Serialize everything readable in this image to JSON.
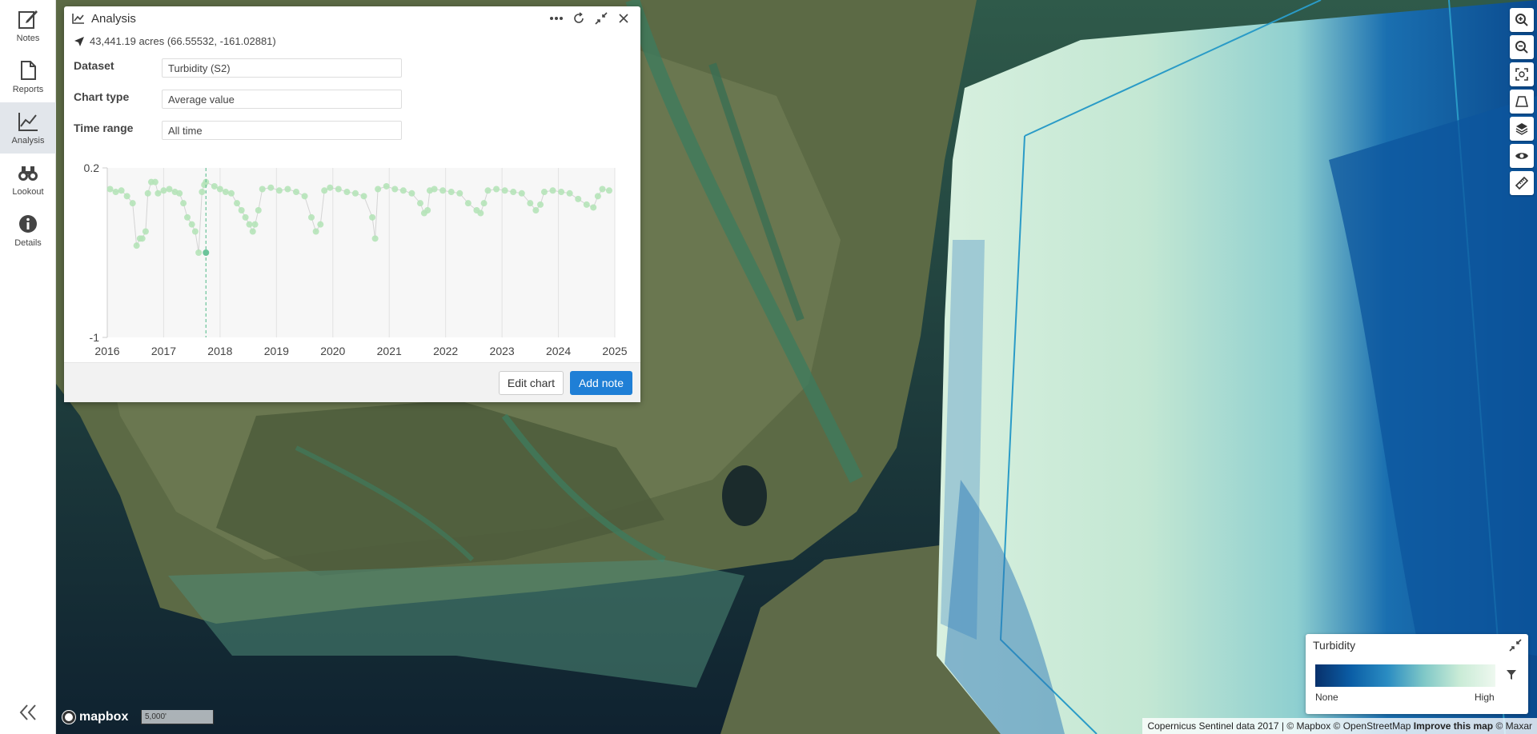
{
  "nav": {
    "items": [
      {
        "label": "Notes",
        "icon": "edit-icon"
      },
      {
        "label": "Reports",
        "icon": "document-icon"
      },
      {
        "label": "Analysis",
        "icon": "chart-icon",
        "active": true
      },
      {
        "label": "Lookout",
        "icon": "binoculars-icon"
      },
      {
        "label": "Details",
        "icon": "info-icon"
      }
    ]
  },
  "panel": {
    "title": "Analysis",
    "location": "43,441.19 acres (66.55532, -161.02881)",
    "fields": [
      {
        "label": "Dataset",
        "value": "Turbidity (S2)"
      },
      {
        "label": "Chart type",
        "value": "Average value"
      },
      {
        "label": "Time range",
        "value": "All time"
      }
    ],
    "edit_label": "Edit chart",
    "add_label": "Add note"
  },
  "chart_data": {
    "type": "scatter",
    "title": "",
    "xlabel": "",
    "ylabel": "",
    "x_ticks": [
      "2016",
      "2017",
      "2018",
      "2019",
      "2020",
      "2021",
      "2022",
      "2023",
      "2024",
      "2025"
    ],
    "y_ticks": [
      "0.2",
      "-1"
    ],
    "ylim": [
      -1,
      0.2
    ],
    "xlim": [
      2016,
      2025
    ],
    "grid": true,
    "color": "#b5e3b8",
    "highlight_x": 2017.75,
    "series": [
      {
        "x": [
          2016.05,
          2016.15,
          2016.25,
          2016.35,
          2016.45,
          2016.52,
          2016.58,
          2016.62,
          2016.68,
          2016.72,
          2016.78,
          2016.85,
          2016.9,
          2017.0,
          2017.1,
          2017.2,
          2017.28,
          2017.35,
          2017.42,
          2017.5,
          2017.56,
          2017.62,
          2017.68,
          2017.72,
          2017.75,
          2017.9,
          2018.0,
          2018.1,
          2018.2,
          2018.3,
          2018.38,
          2018.45,
          2018.52,
          2018.58,
          2018.62,
          2018.68,
          2018.75,
          2018.9,
          2019.05,
          2019.2,
          2019.35,
          2019.5,
          2019.62,
          2019.7,
          2019.78,
          2019.85,
          2019.95,
          2020.1,
          2020.25,
          2020.4,
          2020.55,
          2020.7,
          2020.75,
          2020.8,
          2020.95,
          2021.1,
          2021.25,
          2021.4,
          2021.55,
          2021.62,
          2021.68,
          2021.72,
          2021.8,
          2021.95,
          2022.1,
          2022.25,
          2022.4,
          2022.55,
          2022.62,
          2022.68,
          2022.75,
          2022.9,
          2023.05,
          2023.2,
          2023.35,
          2023.5,
          2023.6,
          2023.68,
          2023.75,
          2023.9,
          2024.05,
          2024.2,
          2024.35,
          2024.5,
          2024.62,
          2024.7,
          2024.78,
          2024.9
        ],
        "values": [
          0.05,
          0.03,
          0.04,
          0.0,
          -0.05,
          -0.35,
          -0.3,
          -0.3,
          -0.25,
          0.02,
          0.1,
          0.1,
          0.02,
          0.04,
          0.05,
          0.03,
          0.02,
          -0.05,
          -0.15,
          -0.2,
          -0.25,
          -0.4,
          0.03,
          0.08,
          0.1,
          0.07,
          0.05,
          0.03,
          0.02,
          -0.05,
          -0.1,
          -0.15,
          -0.2,
          -0.25,
          -0.2,
          -0.1,
          0.05,
          0.06,
          0.04,
          0.05,
          0.03,
          0.0,
          -0.15,
          -0.25,
          -0.2,
          0.04,
          0.06,
          0.05,
          0.03,
          0.02,
          0.0,
          -0.15,
          -0.3,
          0.05,
          0.07,
          0.05,
          0.04,
          0.02,
          -0.05,
          -0.12,
          -0.1,
          0.04,
          0.05,
          0.04,
          0.03,
          0.02,
          -0.05,
          -0.1,
          -0.12,
          -0.05,
          0.04,
          0.05,
          0.04,
          0.03,
          0.02,
          -0.05,
          -0.1,
          -0.06,
          0.03,
          0.04,
          0.03,
          0.02,
          -0.02,
          -0.06,
          -0.08,
          0.0,
          0.05,
          0.04
        ]
      }
    ]
  },
  "legend": {
    "title": "Turbidity",
    "min_label": "None",
    "max_label": "High"
  },
  "map": {
    "scale_label": "5,000'",
    "logo_text": "mapbox",
    "attribution": "Copernicus Sentinel data 2017 | © Mapbox © OpenStreetMap",
    "improve_label": "Improve this map",
    "maxar": "© Maxar"
  }
}
